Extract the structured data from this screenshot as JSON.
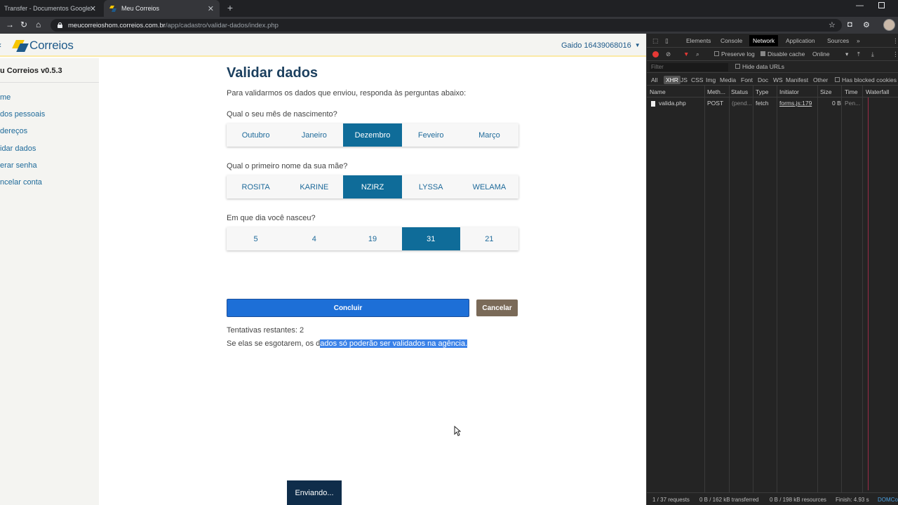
{
  "browser": {
    "tabs": [
      {
        "title": "Transfer - Documentos Google"
      },
      {
        "title": "Meu Correios"
      }
    ],
    "url_host": "meucorreioshom.correios.com.br",
    "url_path": "/app/cadastro/validar-dados/index.php"
  },
  "header": {
    "logo_text": "Correios",
    "user_label": "Gaido 16439068016"
  },
  "sidebar": {
    "title": "u Correios v0.5.3",
    "items": [
      {
        "label": "me"
      },
      {
        "label": "dos pessoais"
      },
      {
        "label": "dereços"
      },
      {
        "label": "idar dados"
      },
      {
        "label": "erar senha"
      },
      {
        "label": "ncelar conta"
      }
    ]
  },
  "main": {
    "title": "Validar dados",
    "intro": "Para validarmos os dados que enviou, responda às perguntas abaixo:",
    "questions": [
      {
        "label": "Qual o seu mês de nascimento?",
        "options": [
          "Outubro",
          "Janeiro",
          "Dezembro",
          "Feveiro",
          "Março"
        ],
        "selected": "Dezembro"
      },
      {
        "label": "Qual o primeiro nome da sua mãe?",
        "options": [
          "ROSITA",
          "KARINE",
          "NZIRZ",
          "LYSSA",
          "WELAMA"
        ],
        "selected": "NZIRZ"
      },
      {
        "label": "Em que dia você nasceu?",
        "options": [
          "5",
          "4",
          "19",
          "31",
          "21"
        ],
        "selected": "31"
      }
    ],
    "submit_label": "Concluir",
    "cancel_label": "Cancelar",
    "tries_text": "Tentativas restantes: 2",
    "warning_plain": "Se elas se esgotarem, os d",
    "warning_highlight": "ados só poderão ser validados na agência.",
    "sending_label": "Enviando..."
  },
  "devtools": {
    "tabs": [
      "Elements",
      "Console",
      "Network",
      "Application",
      "Sources"
    ],
    "active_tab": "Network",
    "toolbar": {
      "preserve_log": "Preserve log",
      "disable_cache": "Disable cache",
      "throttle": "Online"
    },
    "filter_placeholder": "Filter",
    "hide_data_urls": "Hide data URLs",
    "types": [
      "All",
      "XHR",
      "JS",
      "CSS",
      "Img",
      "Media",
      "Font",
      "Doc",
      "WS",
      "Manifest",
      "Other"
    ],
    "selected_type": "XHR",
    "has_blocked_cookies": "Has blocked cookies",
    "columns": [
      "Name",
      "Meth...",
      "Status",
      "Type",
      "Initiator",
      "Size",
      "Time",
      "Waterfall"
    ],
    "rows": [
      {
        "name": "valida.php",
        "method": "POST",
        "status": "(pend...",
        "type": "fetch",
        "initiator": "forms.js:179",
        "size": "0 B",
        "time": "Pen..."
      }
    ],
    "status_bar": {
      "requests": "1 / 37 requests",
      "transferred": "0 B / 162 kB transferred",
      "resources": "0 B / 198 kB resources",
      "finish": "Finish: 4.93 s",
      "dom": "DOMCo"
    }
  }
}
